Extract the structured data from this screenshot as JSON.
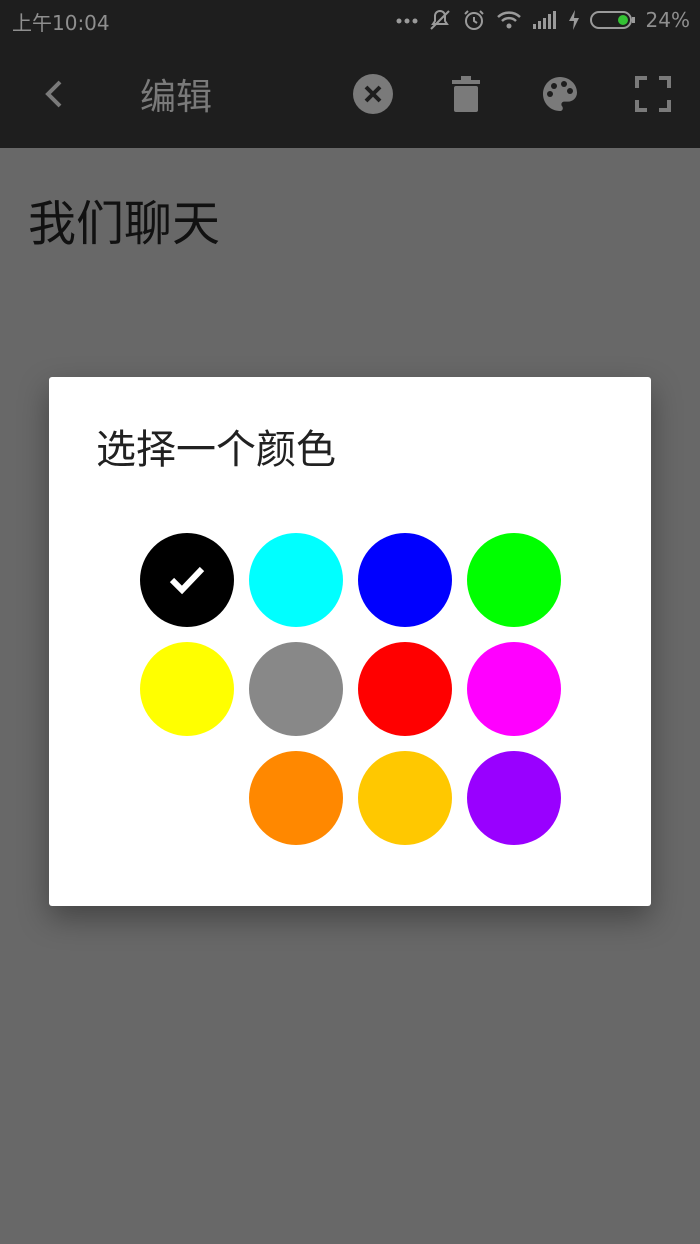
{
  "status_bar": {
    "time": "上午10:04",
    "battery": "24%",
    "icons": [
      "more-dots-icon",
      "bell-off-icon",
      "alarm-icon",
      "wifi-icon",
      "signal-icon",
      "charging-icon",
      "battery-icon"
    ]
  },
  "toolbar": {
    "title": "编辑",
    "actions": [
      "back-icon",
      "close-circle-icon",
      "trash-icon",
      "palette-icon",
      "fullscreen-icon"
    ]
  },
  "note": {
    "title": "我们聊天"
  },
  "dialog": {
    "title": "选择一个颜色",
    "selected": "#000000",
    "swatches": [
      {
        "color": "#000000",
        "selected": true
      },
      {
        "color": "#00FFFF",
        "selected": false
      },
      {
        "color": "#0000FF",
        "selected": false
      },
      {
        "color": "#00FF00",
        "selected": false
      },
      {
        "color": "#FFFF00",
        "selected": false
      },
      {
        "color": "#888888",
        "selected": false
      },
      {
        "color": "#FF0000",
        "selected": false
      },
      {
        "color": "#FF00FF",
        "selected": false
      },
      {
        "color": "#FF8800",
        "selected": false
      },
      {
        "color": "#FFC800",
        "selected": false
      },
      {
        "color": "#9900FF",
        "selected": false
      }
    ]
  }
}
